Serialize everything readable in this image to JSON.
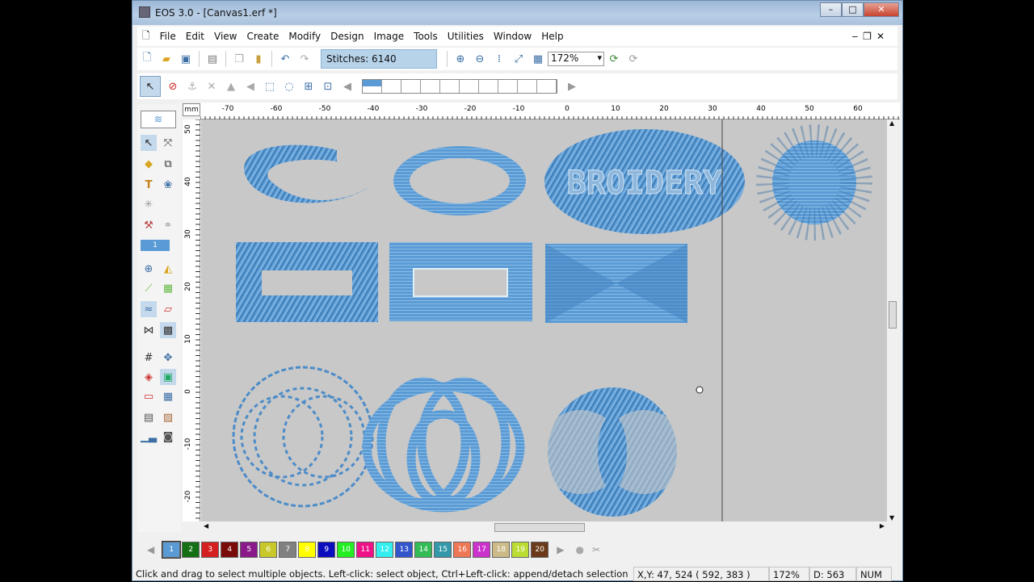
{
  "window": {
    "title": "EOS 3.0 - [Canvas1.erf *]",
    "controls": [
      "minimize",
      "maximize",
      "close"
    ]
  },
  "menu": [
    "File",
    "Edit",
    "View",
    "Create",
    "Modify",
    "Design",
    "Image",
    "Tools",
    "Utilities",
    "Window",
    "Help"
  ],
  "toolbar": {
    "stitches": "Stitches: 6140",
    "zoom": "172%"
  },
  "ruler": {
    "unit": "mm",
    "top_labels": [
      "-70",
      "-60",
      "-50",
      "-40",
      "-30",
      "-20",
      "-10",
      "0",
      "10",
      "20",
      "30",
      "40",
      "50",
      "60"
    ],
    "left_labels": [
      "50",
      "40",
      "30",
      "20",
      "10",
      "0",
      "-10",
      "-20"
    ]
  },
  "canvas": {
    "text_design": "BROIDERY",
    "thread_color": "#5b9bd5"
  },
  "palette": {
    "color_number": "1"
  },
  "colors": [
    {
      "n": "1",
      "c": "#5b9bd5"
    },
    {
      "n": "2",
      "c": "#157015"
    },
    {
      "n": "3",
      "c": "#d42020"
    },
    {
      "n": "4",
      "c": "#7a0a0a"
    },
    {
      "n": "5",
      "c": "#8a1a8a"
    },
    {
      "n": "6",
      "c": "#c8c82a"
    },
    {
      "n": "7",
      "c": "#808080"
    },
    {
      "n": "8",
      "c": "#ffff00"
    },
    {
      "n": "9",
      "c": "#0c0cbf"
    },
    {
      "n": "10",
      "c": "#22ee22"
    },
    {
      "n": "11",
      "c": "#ee1188"
    },
    {
      "n": "12",
      "c": "#33eeee"
    },
    {
      "n": "13",
      "c": "#3355cc"
    },
    {
      "n": "14",
      "c": "#33bb55"
    },
    {
      "n": "15",
      "c": "#3399aa"
    },
    {
      "n": "16",
      "c": "#ee7755"
    },
    {
      "n": "17",
      "c": "#cc33cc"
    },
    {
      "n": "18",
      "c": "#ccbb88"
    },
    {
      "n": "19",
      "c": "#bbdd33"
    },
    {
      "n": "20",
      "c": "#6b3a1a"
    }
  ],
  "status": {
    "hint": "Click and drag to select multiple objects. Left-click: select object, Ctrl+Left-click: append/detach selection",
    "coords": "X,Y: 47, 524  ( 592, 383 )",
    "zoom": "172%",
    "density": "D: 563",
    "num": "NUM"
  }
}
